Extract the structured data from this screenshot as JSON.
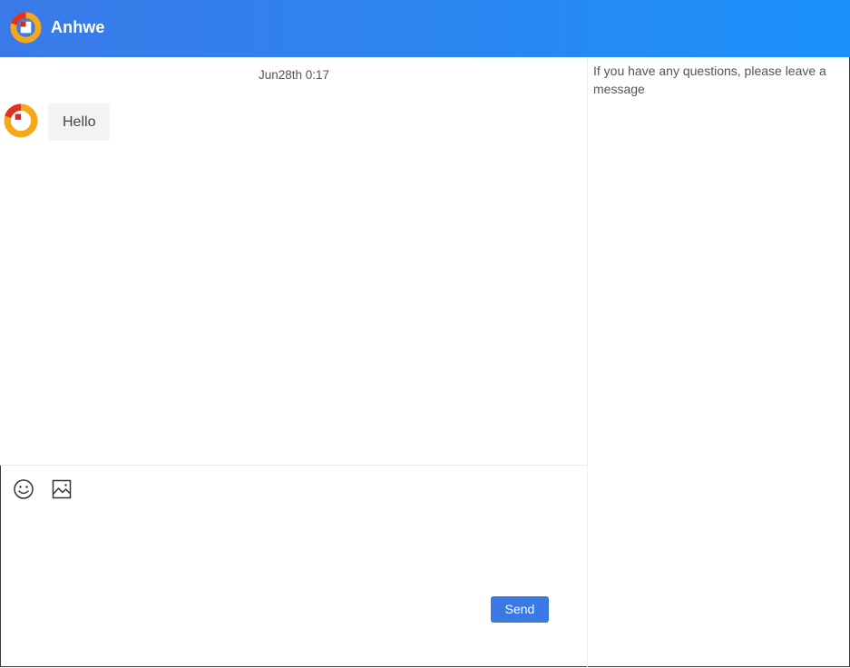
{
  "header": {
    "brand": "Anhwe",
    "logo_icon": "anhwe-logo-icon",
    "gradient": [
      "#3a7ae8",
      "#1a91fb"
    ]
  },
  "chat": {
    "timestamp": "Jun28th 0:17",
    "messages": [
      {
        "sender_avatar_icon": "anhwe-logo-icon",
        "text": "Hello"
      }
    ]
  },
  "toolbar": {
    "emoji_icon": "smiley-face-icon",
    "image_icon": "image-icon"
  },
  "composer": {
    "value": "",
    "placeholder": ""
  },
  "actions": {
    "send_label": "Send",
    "send_color": "#3a78e4"
  },
  "side_panel": {
    "notice": "If you have any questions, please leave a message"
  }
}
